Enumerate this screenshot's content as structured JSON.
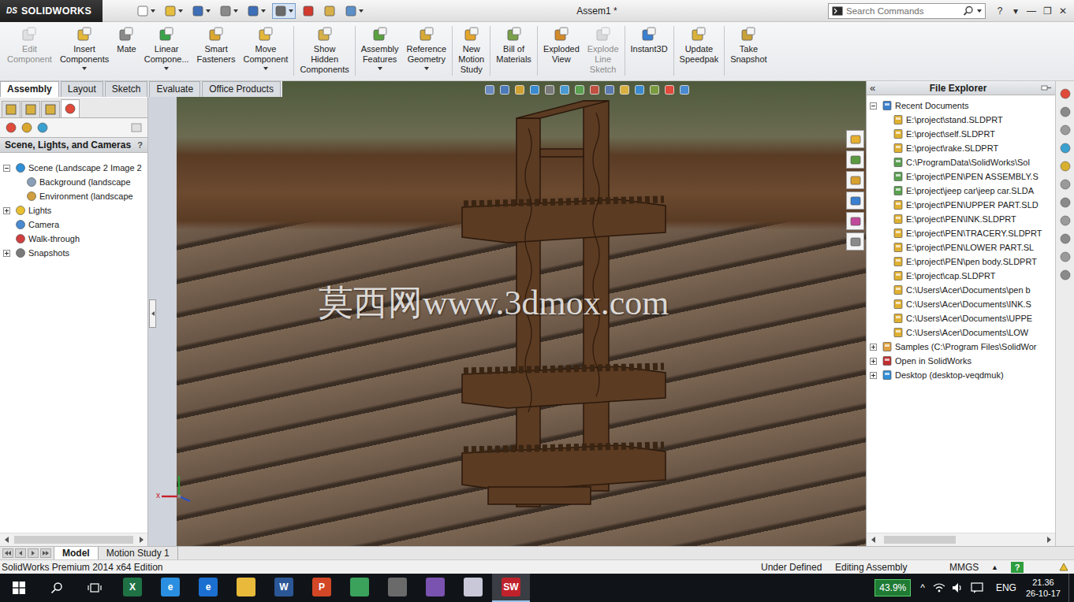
{
  "window": {
    "title": "Assem1 *",
    "logo_mark": "DS",
    "logo": "SOLIDWORKS"
  },
  "quick_access": [
    {
      "dropdown": true,
      "pressed": false
    },
    {
      "dropdown": true,
      "pressed": false
    },
    {
      "dropdown": true,
      "pressed": false
    },
    {
      "dropdown": true,
      "pressed": false
    },
    {
      "dropdown": true,
      "pressed": false
    },
    {
      "dropdown": true,
      "pressed": true
    },
    {
      "dropdown": false,
      "pressed": false
    },
    {
      "dropdown": false,
      "pressed": false
    },
    {
      "dropdown": true,
      "pressed": false
    }
  ],
  "search": {
    "placeholder": "Search Commands"
  },
  "window_controls": [
    "?",
    "▾",
    "—",
    "❐",
    "✕"
  ],
  "ribbon": [
    {
      "lines": [
        "Edit",
        "Component"
      ],
      "disabled": true,
      "dropdown": false,
      "group_end": false
    },
    {
      "lines": [
        "Insert",
        "Components"
      ],
      "disabled": false,
      "dropdown": true,
      "group_end": false
    },
    {
      "lines": [
        "Mate"
      ],
      "disabled": false,
      "dropdown": false,
      "group_end": false
    },
    {
      "lines": [
        "Linear",
        "Compone..."
      ],
      "disabled": false,
      "dropdown": true,
      "group_end": false
    },
    {
      "lines": [
        "Smart",
        "Fasteners"
      ],
      "disabled": false,
      "dropdown": false,
      "group_end": false
    },
    {
      "lines": [
        "Move",
        "Component"
      ],
      "disabled": false,
      "dropdown": true,
      "group_end": true
    },
    {
      "lines": [
        "Show",
        "Hidden",
        "Components"
      ],
      "disabled": false,
      "dropdown": false,
      "group_end": true
    },
    {
      "lines": [
        "Assembly",
        "Features"
      ],
      "disabled": false,
      "dropdown": true,
      "group_end": false
    },
    {
      "lines": [
        "Reference",
        "Geometry"
      ],
      "disabled": false,
      "dropdown": true,
      "group_end": true
    },
    {
      "lines": [
        "New",
        "Motion",
        "Study"
      ],
      "disabled": false,
      "dropdown": false,
      "group_end": true
    },
    {
      "lines": [
        "Bill of",
        "Materials"
      ],
      "disabled": false,
      "dropdown": false,
      "group_end": true
    },
    {
      "lines": [
        "Exploded",
        "View"
      ],
      "disabled": false,
      "dropdown": false,
      "group_end": false
    },
    {
      "lines": [
        "Explode",
        "Line",
        "Sketch"
      ],
      "disabled": true,
      "dropdown": false,
      "group_end": true
    },
    {
      "lines": [
        "Instant3D"
      ],
      "disabled": false,
      "dropdown": false,
      "group_end": true
    },
    {
      "lines": [
        "Update",
        "Speedpak"
      ],
      "disabled": false,
      "dropdown": false,
      "group_end": true
    },
    {
      "lines": [
        "Take",
        "Snapshot"
      ],
      "disabled": false,
      "dropdown": false,
      "group_end": false
    }
  ],
  "command_tabs": [
    {
      "label": "Assembly",
      "selected": true
    },
    {
      "label": "Layout",
      "selected": false
    },
    {
      "label": "Sketch",
      "selected": false
    },
    {
      "label": "Evaluate",
      "selected": false
    },
    {
      "label": "Office Products",
      "selected": false
    }
  ],
  "left_panel": {
    "tabs": [
      {
        "selected": false
      },
      {
        "selected": false
      },
      {
        "selected": false
      },
      {
        "selected": true
      }
    ],
    "header": "Scene, Lights, and Cameras",
    "help": "?",
    "tree": [
      {
        "label": "Scene (Landscape 2 Image 2",
        "level": 0,
        "has_children": true,
        "expanded": true,
        "kind": "scene"
      },
      {
        "label": "Background (landscape",
        "level": 1,
        "has_children": false,
        "expanded": false,
        "kind": "background"
      },
      {
        "label": "Environment (landscape",
        "level": 1,
        "has_children": false,
        "expanded": false,
        "kind": "environment"
      },
      {
        "label": "Lights",
        "level": 0,
        "has_children": true,
        "expanded": false,
        "kind": "lights"
      },
      {
        "label": "Camera",
        "level": 0,
        "has_children": false,
        "expanded": false,
        "kind": "camera"
      },
      {
        "label": "Walk-through",
        "level": 0,
        "has_children": false,
        "expanded": false,
        "kind": "walkthrough"
      },
      {
        "label": "Snapshots",
        "level": 0,
        "has_children": true,
        "expanded": false,
        "kind": "snapshots"
      }
    ]
  },
  "viewport": {
    "watermark": "莫西网www.3dmox.com",
    "triad_label": "x"
  },
  "file_explorer": {
    "collapse": "«",
    "title": "File Explorer",
    "tree": [
      {
        "label": "Recent Documents",
        "level": 0,
        "has_children": true,
        "expanded": true,
        "kind": "recent"
      },
      {
        "label": "E:\\project\\stand.SLDPRT",
        "level": 1,
        "has_children": false,
        "expanded": false,
        "kind": "part"
      },
      {
        "label": "E:\\project\\self.SLDPRT",
        "level": 1,
        "has_children": false,
        "expanded": false,
        "kind": "part"
      },
      {
        "label": "E:\\project\\rake.SLDPRT",
        "level": 1,
        "has_children": false,
        "expanded": false,
        "kind": "part"
      },
      {
        "label": "C:\\ProgramData\\SolidWorks\\Sol",
        "level": 1,
        "has_children": false,
        "expanded": false,
        "kind": "assembly"
      },
      {
        "label": "E:\\project\\PEN\\PEN ASSEMBLY.S",
        "level": 1,
        "has_children": false,
        "expanded": false,
        "kind": "assembly"
      },
      {
        "label": "E:\\project\\jeep car\\jeep car.SLDA",
        "level": 1,
        "has_children": false,
        "expanded": false,
        "kind": "assembly"
      },
      {
        "label": "E:\\project\\PEN\\UPPER PART.SLD",
        "level": 1,
        "has_children": false,
        "expanded": false,
        "kind": "part"
      },
      {
        "label": "E:\\project\\PEN\\INK.SLDPRT",
        "level": 1,
        "has_children": false,
        "expanded": false,
        "kind": "part"
      },
      {
        "label": "E:\\project\\PEN\\TRACERY.SLDPRT",
        "level": 1,
        "has_children": false,
        "expanded": false,
        "kind": "part"
      },
      {
        "label": "E:\\project\\PEN\\LOWER PART.SL",
        "level": 1,
        "has_children": false,
        "expanded": false,
        "kind": "part"
      },
      {
        "label": "E:\\project\\PEN\\pen body.SLDPRT",
        "level": 1,
        "has_children": false,
        "expanded": false,
        "kind": "part"
      },
      {
        "label": "E:\\project\\cap.SLDPRT",
        "level": 1,
        "has_children": false,
        "expanded": false,
        "kind": "part"
      },
      {
        "label": "C:\\Users\\Acer\\Documents\\pen b",
        "level": 1,
        "has_children": false,
        "expanded": false,
        "kind": "part"
      },
      {
        "label": "C:\\Users\\Acer\\Documents\\INK.S",
        "level": 1,
        "has_children": false,
        "expanded": false,
        "kind": "part"
      },
      {
        "label": "C:\\Users\\Acer\\Documents\\UPPE",
        "level": 1,
        "has_children": false,
        "expanded": false,
        "kind": "part"
      },
      {
        "label": "C:\\Users\\Acer\\Documents\\LOW",
        "level": 1,
        "has_children": false,
        "expanded": false,
        "kind": "part"
      },
      {
        "label": "Samples (C:\\Program Files\\SolidWor",
        "level": 0,
        "has_children": true,
        "expanded": false,
        "kind": "samples"
      },
      {
        "label": "Open in SolidWorks",
        "level": 0,
        "has_children": true,
        "expanded": false,
        "kind": "open"
      },
      {
        "label": "Desktop (desktop-veqdmuk)",
        "level": 0,
        "has_children": true,
        "expanded": false,
        "kind": "desktop"
      }
    ]
  },
  "bottom_tabs": [
    {
      "label": "Model",
      "selected": true
    },
    {
      "label": "Motion Study 1",
      "selected": false
    }
  ],
  "status_bar": {
    "product": "SolidWorks Premium 2014 x64 Edition",
    "state": "Under Defined",
    "mode": "Editing Assembly",
    "units": "MMGS",
    "units_caret": "▲",
    "help": "?"
  },
  "taskbar": {
    "apps": [
      {
        "glyph": "X",
        "color": "#1f7244",
        "selected": false
      },
      {
        "glyph": "e",
        "color": "#2a8fe0",
        "selected": false
      },
      {
        "glyph": "e",
        "color": "#1b6fd0",
        "selected": false
      },
      {
        "color": "#e8b93a",
        "selected": false
      },
      {
        "glyph": "W",
        "color": "#2b5797",
        "selected": false
      },
      {
        "glyph": "P",
        "color": "#d24726",
        "selected": false
      },
      {
        "color": "#3aa25a",
        "selected": false
      },
      {
        "color": "#6a6a6a",
        "selected": false
      },
      {
        "color": "#7a52b0",
        "selected": false
      },
      {
        "color": "#c8c8d8",
        "selected": false
      },
      {
        "glyph": "SW",
        "color": "#c0222c",
        "selected": true
      }
    ],
    "battery": "43.9%",
    "tray_caret": "^",
    "language": "ENG",
    "time": "21.36",
    "date": "26-10-17"
  }
}
